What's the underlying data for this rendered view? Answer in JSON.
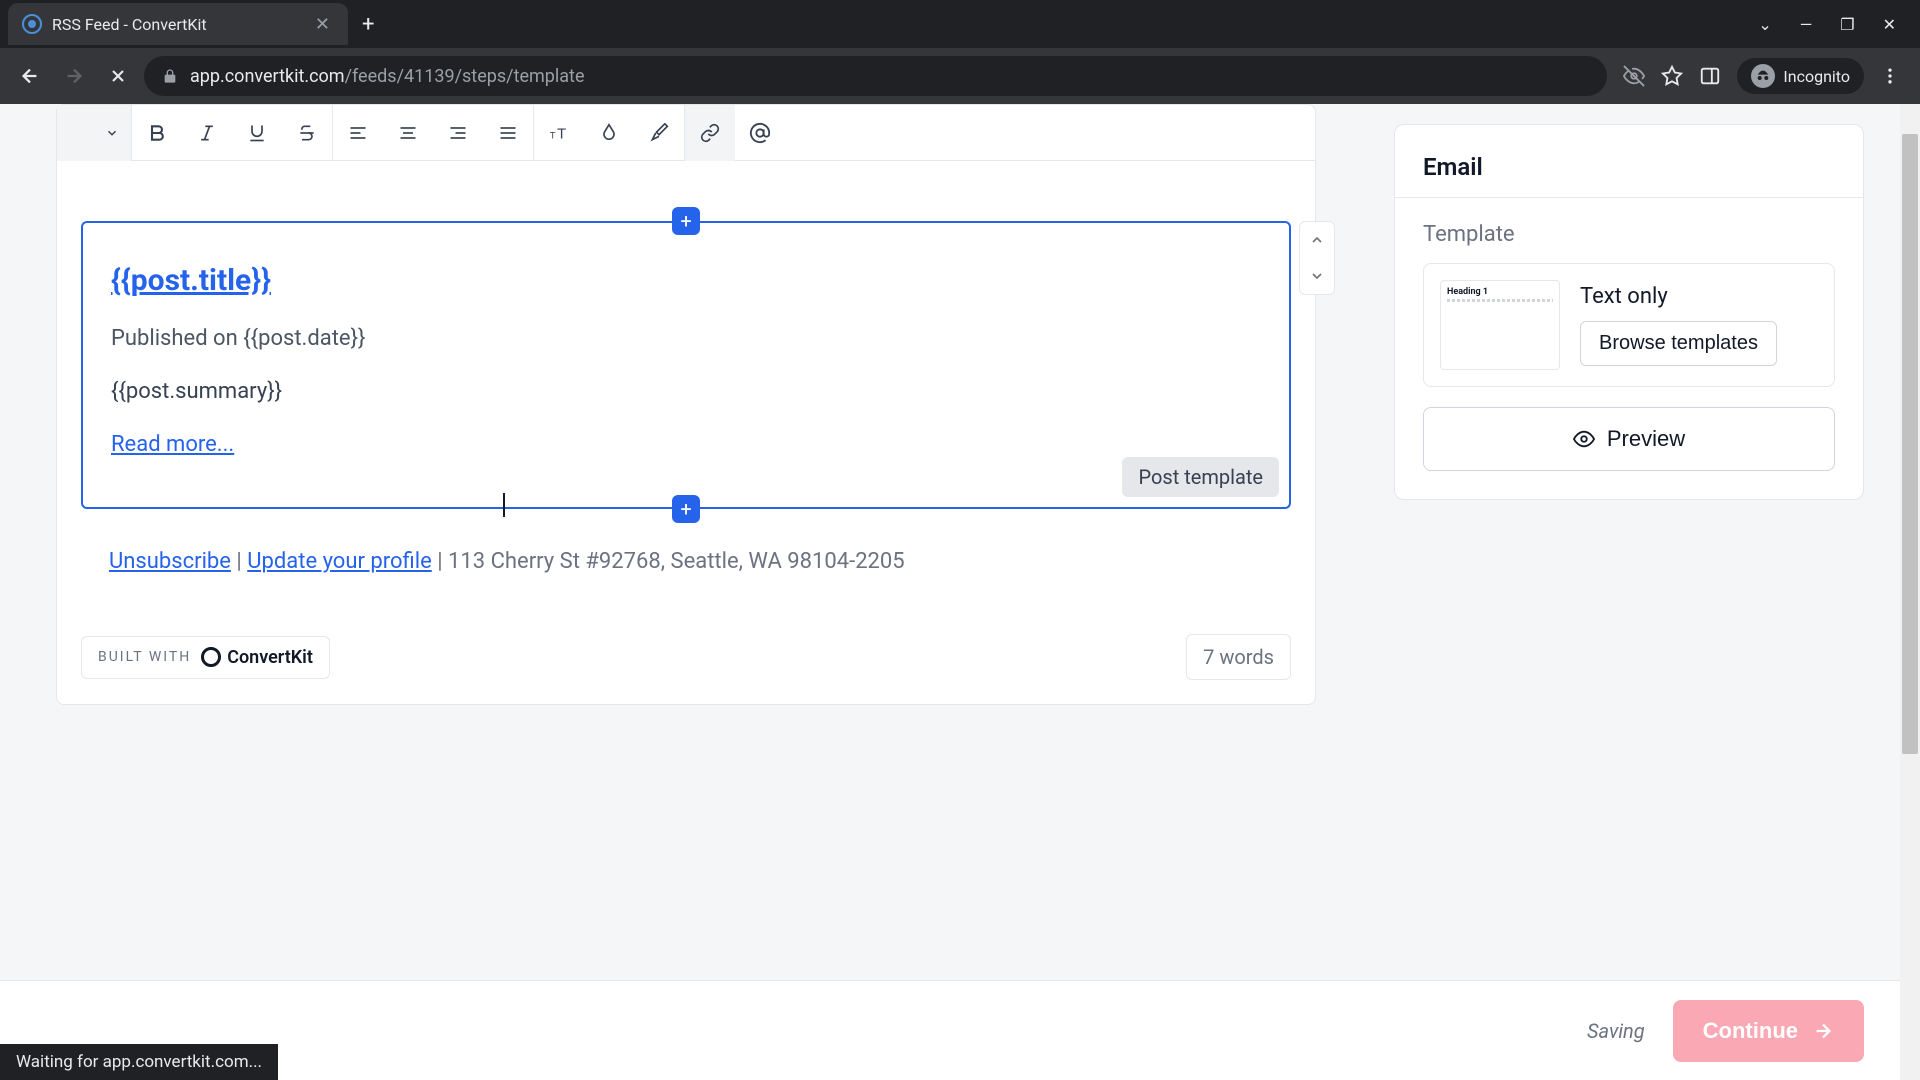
{
  "browser": {
    "tab_title": "RSS Feed - ConvertKit",
    "url_domain": "app.convertkit.com",
    "url_path": "/feeds/41139/steps/template",
    "incognito_label": "Incognito",
    "status_text": "Waiting for app.convertkit.com..."
  },
  "editor": {
    "post_title": "{{post.title}}",
    "published_prefix": "Published on ",
    "published_date": "{{post.date}}",
    "summary": "{{post.summary}}",
    "read_more": "Read more...",
    "block_label": "Post template"
  },
  "footer": {
    "unsubscribe": "Unsubscribe",
    "sep1": " | ",
    "update_profile": "Update your profile",
    "sep2": " | ",
    "address": "113 Cherry St #92768, Seattle, WA 98104-2205",
    "built_with": "BUILT WITH",
    "brand": "ConvertKit",
    "word_count": "7 words"
  },
  "sidebar": {
    "title": "Email",
    "template_label": "Template",
    "thumb_heading": "Heading 1",
    "template_name": "Text only",
    "browse": "Browse templates",
    "preview": "Preview"
  },
  "bottom": {
    "saving": "Saving",
    "continue": "Continue"
  }
}
